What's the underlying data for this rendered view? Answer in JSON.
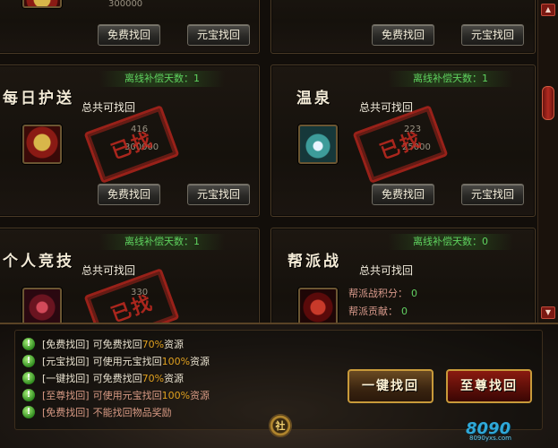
{
  "cards": {
    "top_left": {
      "reward": "300000",
      "free_btn": "免费找回",
      "gold_btn": "元宝找回"
    },
    "top_right": {
      "free_btn": "免费找回",
      "gold_btn": "元宝找回"
    },
    "escort": {
      "title": "每日护送",
      "days": "离线补偿天数：1",
      "total": "总共可找回",
      "reward_a": "416",
      "reward_b": "300000",
      "stamp": "已找",
      "free_btn": "免费找回",
      "gold_btn": "元宝找回"
    },
    "spring": {
      "title": "温泉",
      "days": "离线补偿天数：1",
      "total": "总共可找回",
      "reward_a": "223",
      "reward_b": "25000",
      "stamp": "已找",
      "free_btn": "免费找回",
      "gold_btn": "元宝找回"
    },
    "arena": {
      "title": "个人竞技",
      "days": "离线补偿天数：1",
      "total": "总共可找回",
      "reward_a": "330",
      "stamp": "已找"
    },
    "guild_war": {
      "title": "帮派战",
      "days": "离线补偿天数：0",
      "total": "总共可找回",
      "stat1_label": "帮派战积分：",
      "stat1_value": "0",
      "stat2_label": "帮派贡献：",
      "stat2_value": "0"
    }
  },
  "scrollbar": {
    "up": "▲",
    "down": "▼"
  },
  "rules": [
    {
      "label": "[免费找回]",
      "pre": "可免费找回",
      "pct": "70%",
      "post": "资源",
      "style": "normal"
    },
    {
      "label": "[元宝找回]",
      "pre": "可使用元宝找回",
      "pct": "100%",
      "post": "资源",
      "style": "normal"
    },
    {
      "label": "[一键找回]",
      "pre": "可免费找回",
      "pct": "70%",
      "post": "资源",
      "style": "normal"
    },
    {
      "label": "[至尊找回]",
      "pre": "可使用元宝找回",
      "pct": "100%",
      "post": "资源",
      "style": "red"
    },
    {
      "label": "[免费找回]",
      "pre": "不能找回物品奖励",
      "pct": "",
      "post": "",
      "style": "red"
    }
  ],
  "rule_icon": "!",
  "buttons": {
    "one_click": "一键找回",
    "supreme": "至尊找回"
  },
  "emblem": "社",
  "logo": {
    "main": "8090",
    "sub": "8090yxs.com"
  }
}
